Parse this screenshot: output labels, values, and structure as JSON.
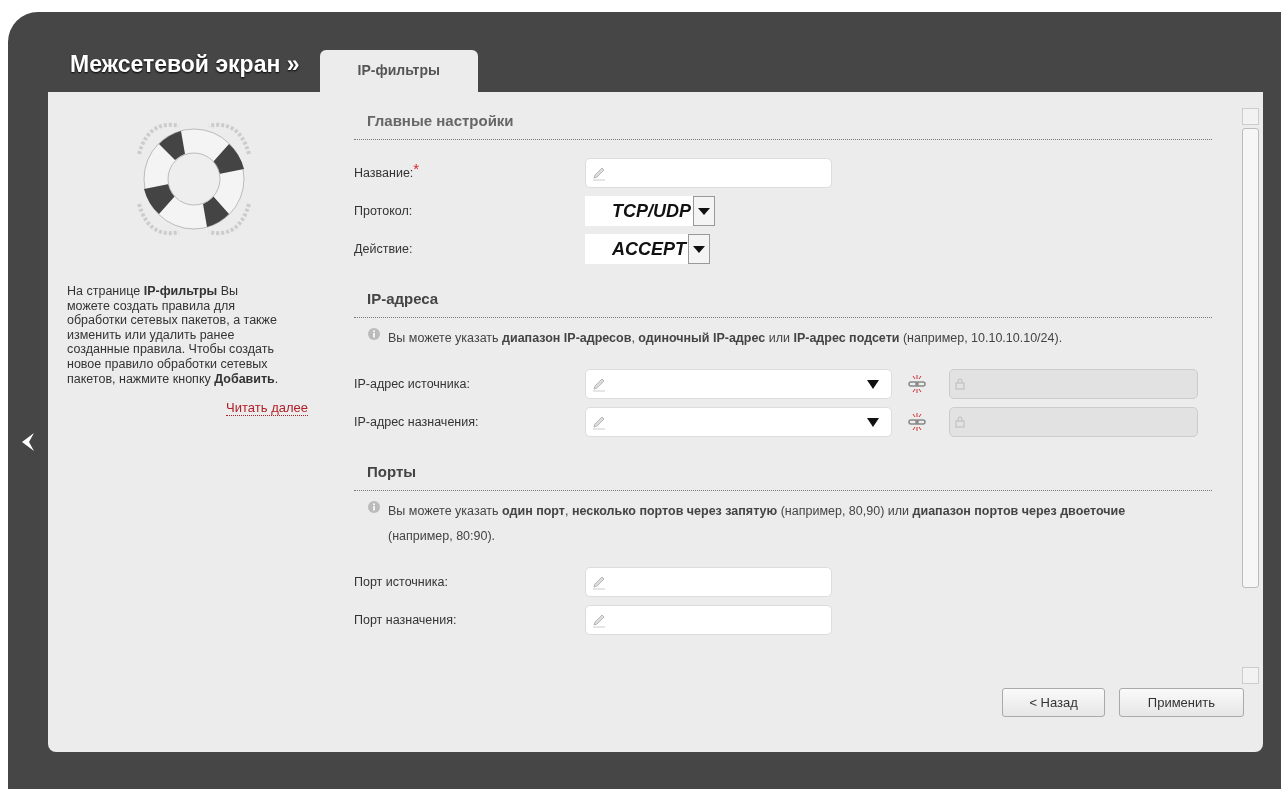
{
  "header": {
    "title": "Межсетевой экран »",
    "tabs": [
      {
        "label": "IP-фильтры",
        "selected": true
      }
    ]
  },
  "help": {
    "text": "На странице **IP-фильтры** Вы можете создать правила для обработки сетевых пакетов, а также изменить или удалить ранее созданные правила. Чтобы создать новое правило обработки сетевых пакетов, нажмите кнопку **Добавить**.",
    "link": "Читать далее"
  },
  "sections": [
    {
      "title": "Главные настройки",
      "rows": [
        {
          "kind": "text",
          "label": "Название:",
          "required_mark": "*"
        },
        {
          "kind": "select",
          "label": "Протокол:",
          "value": "TCP/UDP"
        },
        {
          "kind": "select",
          "label": "Действие:",
          "value": "ACCEPT"
        }
      ]
    },
    {
      "title": "IP-адреса",
      "notice": "Вы можете указать **диапазон IP-адресов**, **одиночный IP-адрес** или **IP-адрес подсети** (например, 10.10.10.10/24).",
      "rows": [
        {
          "kind": "ip",
          "label": "IP-адрес источника:"
        },
        {
          "kind": "ip",
          "label": "IP-адрес назначения:"
        }
      ]
    },
    {
      "title": "Порты",
      "notice": "Вы можете указать **один порт**, **несколько портов через запятую** (например, 80,90) или **диапазон портов через двоеточие** (например, 80:90).",
      "rows": [
        {
          "kind": "text",
          "label": "Порт источника:"
        },
        {
          "kind": "text",
          "label": "Порт назначения:"
        }
      ]
    }
  ],
  "buttons": [
    "< Назад",
    "Применить"
  ]
}
